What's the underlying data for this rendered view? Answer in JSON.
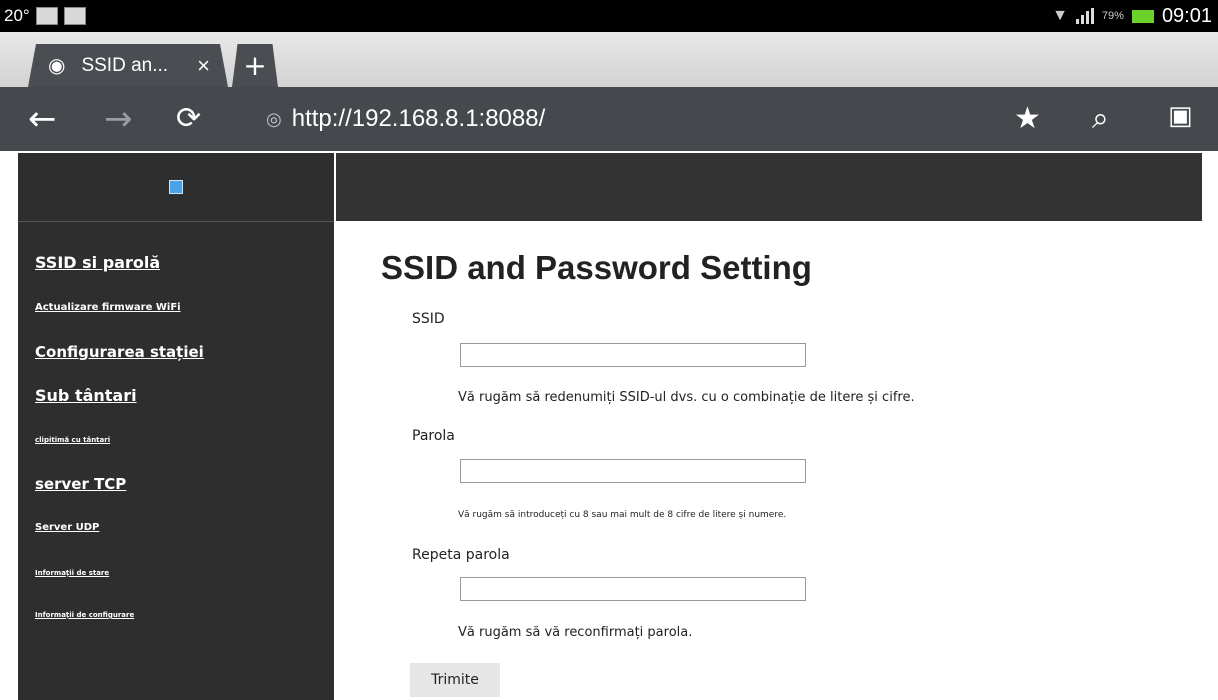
{
  "status_bar": {
    "temperature": "20°",
    "battery_pct": "79%",
    "time": "09:01",
    "icons": [
      "notification-icon",
      "image-icon",
      "wifi-icon",
      "signal-icon",
      "battery-icon"
    ]
  },
  "browser": {
    "tab_title": "SSID an...",
    "tab_close": "×",
    "new_tab": "+",
    "url": "http://192.168.8.1:8088/",
    "nav_icons": [
      "back-icon",
      "forward-icon",
      "reload-icon",
      "bookmark-star-icon",
      "search-icon",
      "bookmarks-icon"
    ]
  },
  "sidebar": {
    "items": [
      {
        "label": "SSID si parolă"
      },
      {
        "label": "Actualizare firmware WiFi"
      },
      {
        "label": "Configurarea stației"
      },
      {
        "label": "Sub tântari"
      },
      {
        "label": "clipitimă cu tântari"
      },
      {
        "label": "server TCP"
      },
      {
        "label": "Server UDP"
      },
      {
        "label": "Informații de stare"
      },
      {
        "label": "Informații de configurare"
      }
    ]
  },
  "form": {
    "title": "SSID and Password Setting",
    "ssid_label": "SSID",
    "ssid_value": "",
    "ssid_hint": "Vă rugăm să redenumiți SSID-ul dvs. cu o combinație de litere și cifre.",
    "password_label": "Parola",
    "password_value": "",
    "password_hint": "Vă rugăm să introduceți cu 8 sau mai mult de 8 cifre de litere și numere.",
    "repeat_label": "Repeta parola",
    "repeat_value": "",
    "repeat_hint": "Vă rugăm să vă reconfirmați parola.",
    "submit_label": "Trimite"
  }
}
